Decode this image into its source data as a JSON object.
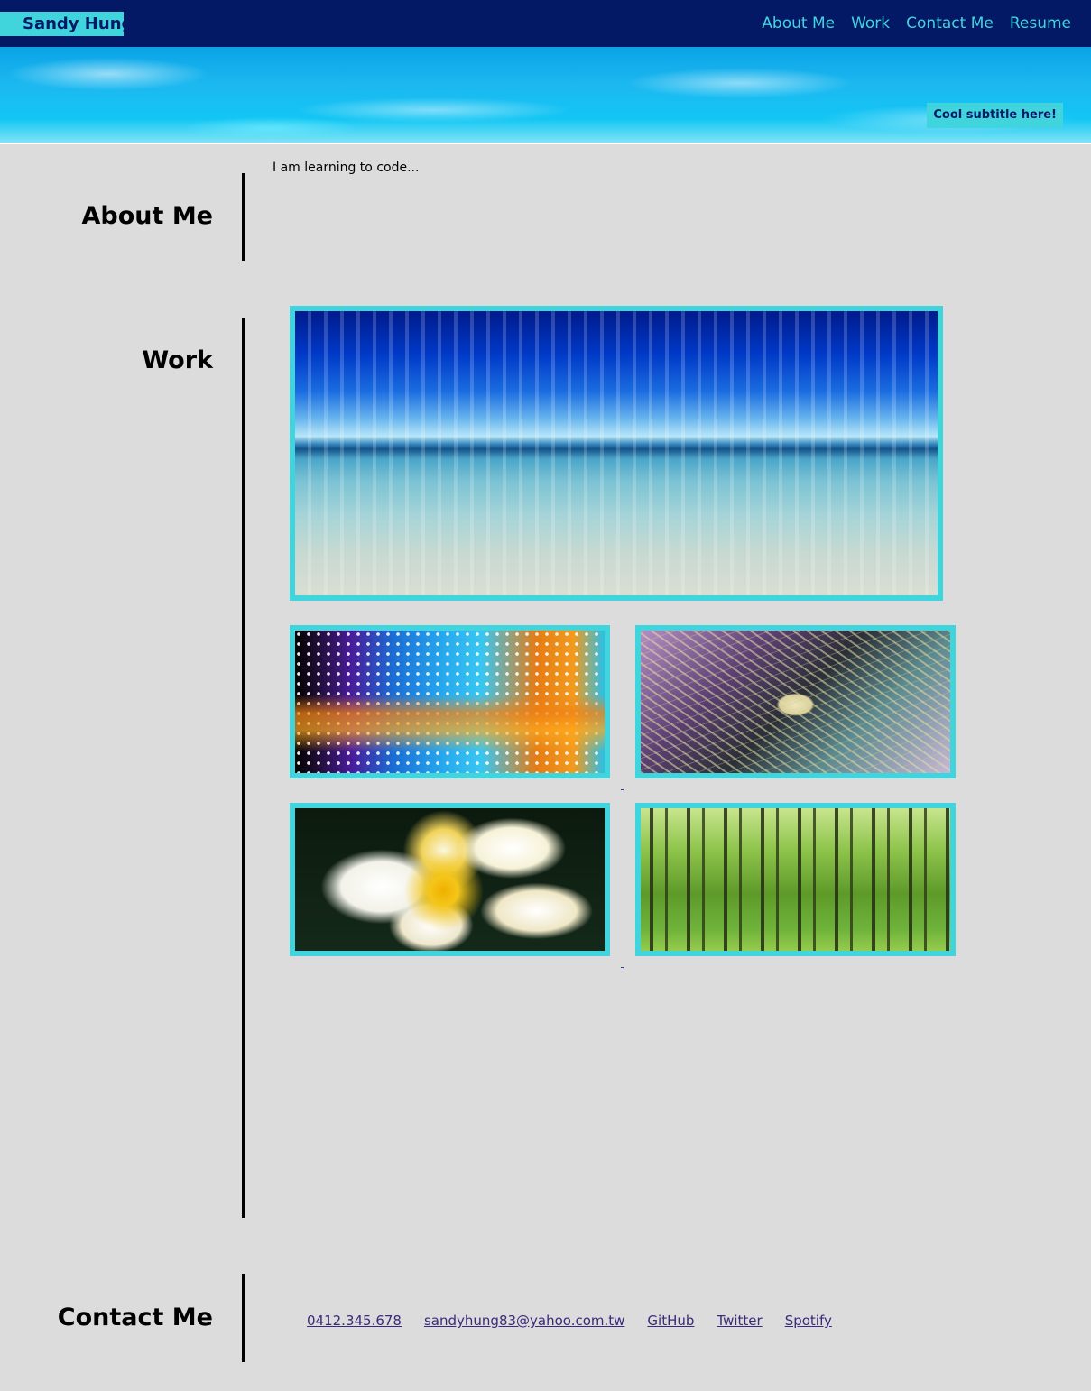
{
  "nav": {
    "brand": "Sandy Hung",
    "links": [
      "About Me",
      "Work",
      "Contact Me",
      "Resume"
    ]
  },
  "hero": {
    "subtitle": "Cool subtitle here!"
  },
  "about": {
    "heading": "About Me",
    "text": "I am learning to code..."
  },
  "work": {
    "heading": "Work",
    "images": [
      "ocean-photo",
      "led-display-photo",
      "circuit-board-photo",
      "plumeria-flower-photo",
      "forest-photo"
    ]
  },
  "contact": {
    "heading": "Contact Me",
    "links": [
      "0412.345.678",
      "sandyhung83@yahoo.com.tw",
      "GitHub",
      "Twitter",
      "Spotify"
    ]
  },
  "colors": {
    "navbar": "#031966",
    "accent": "#40d5dc",
    "background": "#dcdcdc",
    "link": "#3b2a7a"
  }
}
